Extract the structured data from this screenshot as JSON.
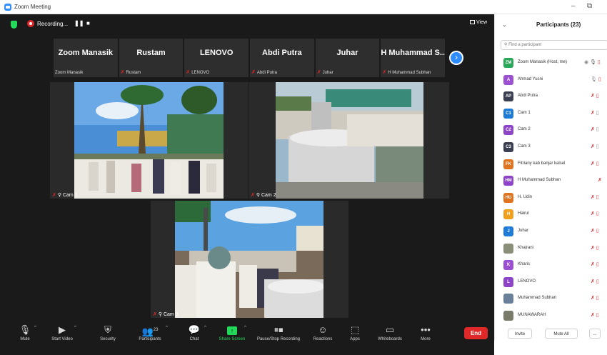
{
  "window": {
    "title": "Zoom Meeting",
    "minimize": "–",
    "restore": "⧉"
  },
  "topbar": {
    "recording_label": "Recording...",
    "pause": "❚❚",
    "stop": "■",
    "view_label": "View"
  },
  "strip": [
    {
      "name": "Zoom Manasik",
      "tag": "Zoom Manasik",
      "muted": false
    },
    {
      "name": "Rustam",
      "tag": "Rustam",
      "muted": true
    },
    {
      "name": "LENOVO",
      "tag": "LENOVO",
      "muted": true
    },
    {
      "name": "Abdi Putra",
      "tag": "Abdi Putra",
      "muted": true
    },
    {
      "name": "Juhar",
      "tag": "Juhar",
      "muted": true
    },
    {
      "name": "H Muhammad S...",
      "tag": "H Muhammad Subhan",
      "muted": true
    }
  ],
  "tiles": {
    "cam1": "Cam 1",
    "cam2": "Cam 2",
    "cam3": "Cam 3"
  },
  "controls": {
    "mute": "Mute",
    "start_video": "Start Video",
    "security": "Security",
    "participants": "Participants",
    "participants_count": "23",
    "chat": "Chat",
    "share_screen": "Share Screen",
    "pause_recording": "Pause/Stop Recording",
    "reactions": "Reactions",
    "apps": "Apps",
    "whiteboards": "Whiteboards",
    "more": "More",
    "end": "End"
  },
  "panel": {
    "title": "Participants (23)",
    "search_placeholder": "Find a participant",
    "invite": "Invite",
    "mute_all": "Mute All",
    "more": "...",
    "participants": [
      {
        "initials": "ZM",
        "name": "Zoom Manasik (Host, me)",
        "color": "#2aa85a",
        "host": true
      },
      {
        "initials": "A",
        "name": "Ahmad Yusni",
        "color": "#9b4fd1"
      },
      {
        "initials": "AP",
        "name": "Abdi Putra",
        "color": "#3a3f52"
      },
      {
        "initials": "C1",
        "name": "Cam 1",
        "color": "#1e7bd6"
      },
      {
        "initials": "C2",
        "name": "Cam 2",
        "color": "#8e44c7"
      },
      {
        "initials": "C3",
        "name": "Cam 3",
        "color": "#3a3f52"
      },
      {
        "initials": "FK",
        "name": "Fitriany kab banjar kalsel",
        "color": "#e0741e"
      },
      {
        "initials": "HM",
        "name": "H Muhammad Subhan",
        "color": "#8e44c7"
      },
      {
        "initials": "HU",
        "name": "H. Udin",
        "color": "#e0741e"
      },
      {
        "initials": "H",
        "name": "Hairul",
        "color": "#f0a020"
      },
      {
        "initials": "J",
        "name": "Juhar",
        "color": "#1e7bd6"
      },
      {
        "initials": "",
        "name": "Khairani",
        "color": "#8a8f7a",
        "photo": true
      },
      {
        "initials": "K",
        "name": "Kharis",
        "color": "#9b4fd1"
      },
      {
        "initials": "L",
        "name": "LENOVO",
        "color": "#8e44c7"
      },
      {
        "initials": "",
        "name": "Muhammad Subhan",
        "color": "#6a7f9a",
        "photo": true
      },
      {
        "initials": "",
        "name": "MUNAWARAH",
        "color": "#7a7a6a",
        "photo": true
      }
    ]
  }
}
